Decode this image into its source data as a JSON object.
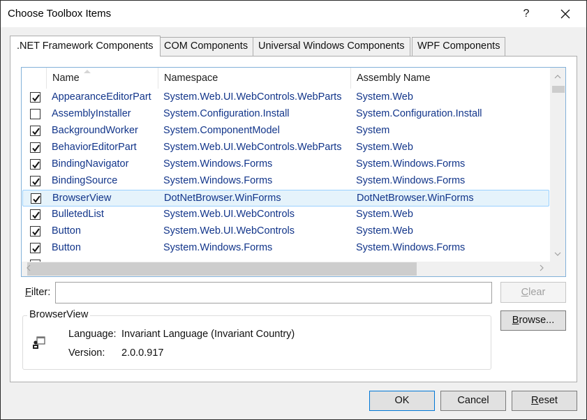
{
  "window": {
    "title": "Choose Toolbox Items",
    "help_label": "?",
    "close_label": "✕"
  },
  "tabs": [
    {
      "label": ".NET Framework Components",
      "active": true
    },
    {
      "label": "COM Components",
      "active": false
    },
    {
      "label": "Universal Windows Components",
      "active": false
    },
    {
      "label": "WPF Components",
      "active": false
    }
  ],
  "list": {
    "columns": [
      "Name",
      "Namespace",
      "Assembly Name"
    ],
    "sort_column": "Name",
    "sort_direction": "ascending",
    "rows": [
      {
        "checked": true,
        "name": "AppearanceEditorPart",
        "namespace": "System.Web.UI.WebControls.WebParts",
        "assembly": "System.Web",
        "selected": false
      },
      {
        "checked": false,
        "name": "AssemblyInstaller",
        "namespace": "System.Configuration.Install",
        "assembly": "System.Configuration.Install",
        "selected": false
      },
      {
        "checked": true,
        "name": "BackgroundWorker",
        "namespace": "System.ComponentModel",
        "assembly": "System",
        "selected": false
      },
      {
        "checked": true,
        "name": "BehaviorEditorPart",
        "namespace": "System.Web.UI.WebControls.WebParts",
        "assembly": "System.Web",
        "selected": false
      },
      {
        "checked": true,
        "name": "BindingNavigator",
        "namespace": "System.Windows.Forms",
        "assembly": "System.Windows.Forms",
        "selected": false
      },
      {
        "checked": true,
        "name": "BindingSource",
        "namespace": "System.Windows.Forms",
        "assembly": "System.Windows.Forms",
        "selected": false
      },
      {
        "checked": true,
        "name": "BrowserView",
        "namespace": "DotNetBrowser.WinForms",
        "assembly": "DotNetBrowser.WinForms",
        "selected": true
      },
      {
        "checked": true,
        "name": "BulletedList",
        "namespace": "System.Web.UI.WebControls",
        "assembly": "System.Web",
        "selected": false
      },
      {
        "checked": true,
        "name": "Button",
        "namespace": "System.Web.UI.WebControls",
        "assembly": "System.Web",
        "selected": false
      },
      {
        "checked": true,
        "name": "Button",
        "namespace": "System.Windows.Forms",
        "assembly": "System.Windows.Forms",
        "selected": false
      }
    ]
  },
  "filter": {
    "label_mnemonic": "F",
    "label_rest": "ilter:",
    "value": "",
    "placeholder": ""
  },
  "buttons": {
    "clear_mnemonic": "C",
    "clear_rest": "lear",
    "browse_mnemonic": "B",
    "browse_rest": "rowse...",
    "ok": "OK",
    "cancel": "Cancel",
    "reset_mnemonic": "R",
    "reset_rest": "eset"
  },
  "details": {
    "group_title": "BrowserView",
    "icon": "component-icon",
    "language_label": "Language:",
    "language_value": "Invariant Language (Invariant Country)",
    "version_label": "Version:",
    "version_value": "2.0.0.917"
  },
  "colors": {
    "item_text": "#12358a",
    "selection_bg": "#e5f3fb",
    "selection_border": "#99d1ff",
    "list_border": "#82b1d9",
    "default_button_border": "#0078d7"
  }
}
